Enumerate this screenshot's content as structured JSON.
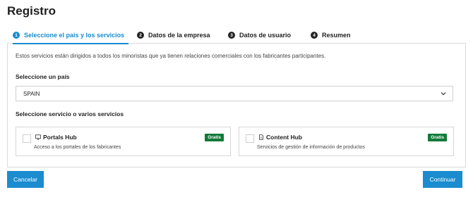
{
  "page": {
    "title": "Registro"
  },
  "steps": [
    {
      "number": "1",
      "label": "Seleccione el país y los servicios",
      "active": true
    },
    {
      "number": "2",
      "label": "Datos de la empresa",
      "active": false
    },
    {
      "number": "3",
      "label": "Datos de usuario",
      "active": false
    },
    {
      "number": "4",
      "label": "Resumen",
      "active": false
    }
  ],
  "form": {
    "intro": "Estos servicios están dirigidos a todos los minoristas que ya tienen relaciones comerciales con los fabricantes participantes.",
    "country_label": "Seleccione un país",
    "country_value": "SPAIN",
    "services_label": "Seleccione servicio o varios servicios"
  },
  "services": [
    {
      "name": "Portals Hub",
      "description": "Acceso a los portales de los fabricantes",
      "badge": "Gratis",
      "icon": "monitor-icon",
      "checked": false
    },
    {
      "name": "Content Hub",
      "description": "Servicios de gestión de información de productos",
      "badge": "Gratis",
      "icon": "document-icon",
      "checked": false
    }
  ],
  "actions": {
    "cancel": "Cancelar",
    "continue": "Continuar"
  },
  "colors": {
    "accent": "#1a8ccf",
    "badge": "#137a3a"
  }
}
